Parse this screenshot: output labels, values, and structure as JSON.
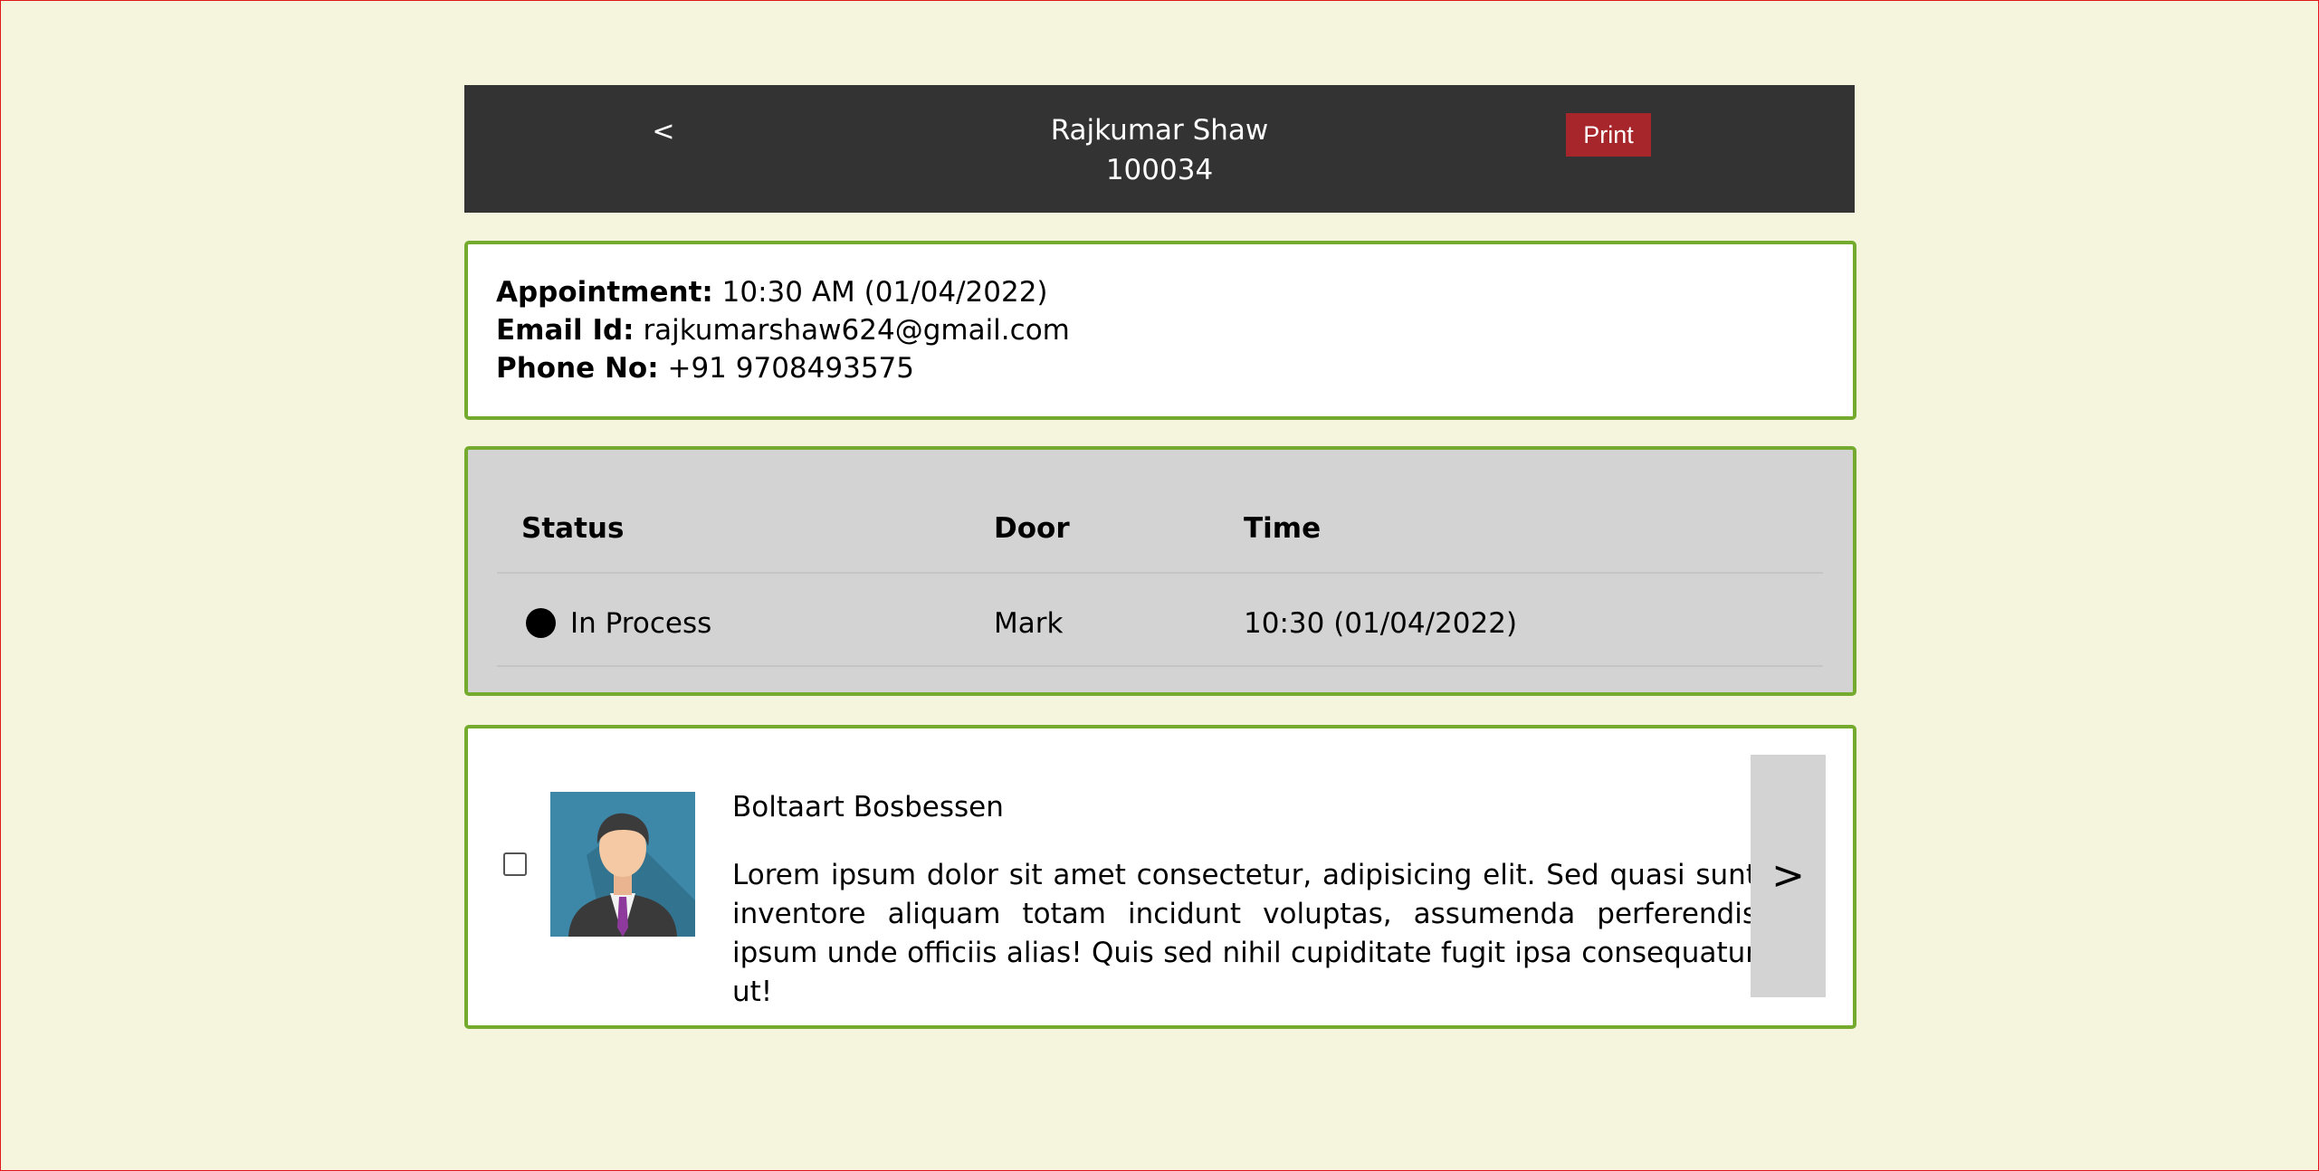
{
  "header": {
    "back_label": "<",
    "name": "Rajkumar Shaw",
    "id": "100034",
    "print_label": "Print"
  },
  "info": {
    "appointment_label": "Appointment:",
    "appointment_value": "10:30 AM (01/04/2022)",
    "email_label": "Email Id:",
    "email_value": "rajkumarshaw624@gmail.com",
    "phone_label": "Phone No:",
    "phone_value": "+91 9708493575"
  },
  "status_table": {
    "headers": [
      "Status",
      "Door",
      "Time"
    ],
    "rows": [
      [
        "In Process",
        "Mark",
        "10:30 (01/04/2022)"
      ]
    ]
  },
  "person": {
    "name": "Boltaart Bosbessen",
    "description": "Lorem ipsum dolor sit amet consectetur, adipisicing elit. Sed quasi sunt inventore aliquam totam incidunt voluptas, assumenda perferendis ipsum unde officiis alias! Quis sed nihil cupiditate fugit ipsa consequatur ut!",
    "next_label": ">",
    "avatar_icon": "person-avatar-icon"
  },
  "colors": {
    "background": "#f5f4dc",
    "header": "#333333",
    "print_button": "#a6262b",
    "card_border": "#74ab2e",
    "status_panel": "#d3d3d3"
  }
}
